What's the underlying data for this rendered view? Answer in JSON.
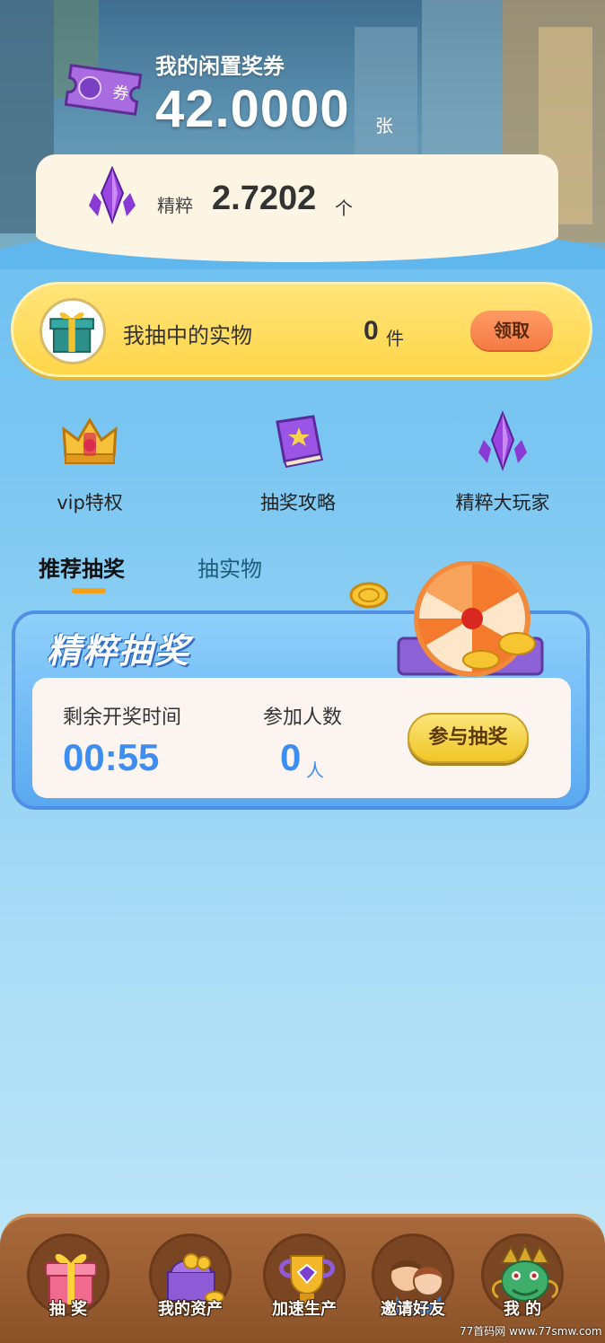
{
  "header": {
    "voucher_title": "我的闲置奖券",
    "voucher_value": "42.0000",
    "voucher_unit": "张",
    "voucher_icon_label": "券",
    "essence_label": "精粹",
    "essence_value": "2.7202",
    "essence_unit": "个"
  },
  "prize_bar": {
    "label": "我抽中的实物",
    "count": "0",
    "unit": "件",
    "claim_label": "领取"
  },
  "shortcuts": [
    {
      "label": "vip特权",
      "icon": "crown-icon"
    },
    {
      "label": "抽奖攻略",
      "icon": "book-icon"
    },
    {
      "label": "精粹大玩家",
      "icon": "crystal-icon"
    }
  ],
  "tabs": [
    {
      "label": "推荐抽奖",
      "active": true
    },
    {
      "label": "抽实物",
      "active": false
    }
  ],
  "lottery": {
    "title": "精粹抽奖",
    "remaining_label": "剩余开奖时间",
    "remaining_value": "00:55",
    "participants_label": "参加人数",
    "participants_value": "0",
    "participants_unit": "人",
    "join_label": "参与抽奖"
  },
  "bottom_nav": [
    {
      "label": "抽  奖",
      "icon": "gift-box-icon"
    },
    {
      "label": "我的资产",
      "icon": "wallet-coins-icon"
    },
    {
      "label": "加速生产",
      "icon": "trophy-gem-icon"
    },
    {
      "label": "邀请好友",
      "icon": "friends-icon"
    },
    {
      "label": "我  的",
      "icon": "dragon-icon"
    }
  ],
  "watermark": "77首码网 www.77smw.com",
  "colors": {
    "accent_blue": "#3d8ef0",
    "prize_yellow": "#ffd64a",
    "claim_orange": "#f57b45",
    "nav_brown": "#8b5228",
    "tab_underline": "#f3a21a"
  }
}
